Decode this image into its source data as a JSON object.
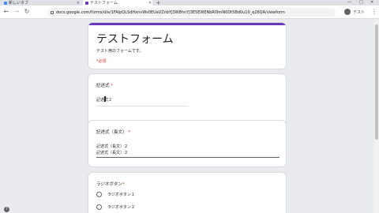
{
  "browser": {
    "tabs": [
      {
        "label": "新しいタブ",
        "favicon_color": "#4285f4"
      },
      {
        "label": "テストフォーム",
        "favicon_color": "#673ab7"
      }
    ],
    "new_tab": "+",
    "window_controls": {
      "min": "—",
      "max": "□",
      "close": "✕"
    },
    "url": "docs.google.com/forms/d/e/1FAIpQLSdHxnvWs0EUaVZnbYJ3W8hnYJ3E5EWENbRI9mN0Dt5Bd0u10_q26QA/viewform",
    "profile_name": "テスト"
  },
  "form": {
    "title": "テストフォーム",
    "description": "テスト用のフォームです。",
    "required_note": "*必須",
    "accent_color": "#673ab7",
    "questions": [
      {
        "title": "記述式",
        "required_mark": "*",
        "answer": "記述式２"
      },
      {
        "title": "記述式（長文）",
        "required_mark": "*",
        "answer_lines": [
          "記述式（長文）２",
          "記述式（長文）２"
        ]
      },
      {
        "title": "ラジオボタン",
        "required_mark": "*",
        "options": [
          "ラジオボタン１",
          "ラジオボタン２"
        ]
      }
    ]
  },
  "icons": {
    "back": "back-arrow-icon",
    "forward": "forward-arrow-icon",
    "reload": "reload-icon",
    "lock": "lock-icon",
    "menu": "more-vert-icon",
    "help": "help-icon"
  }
}
